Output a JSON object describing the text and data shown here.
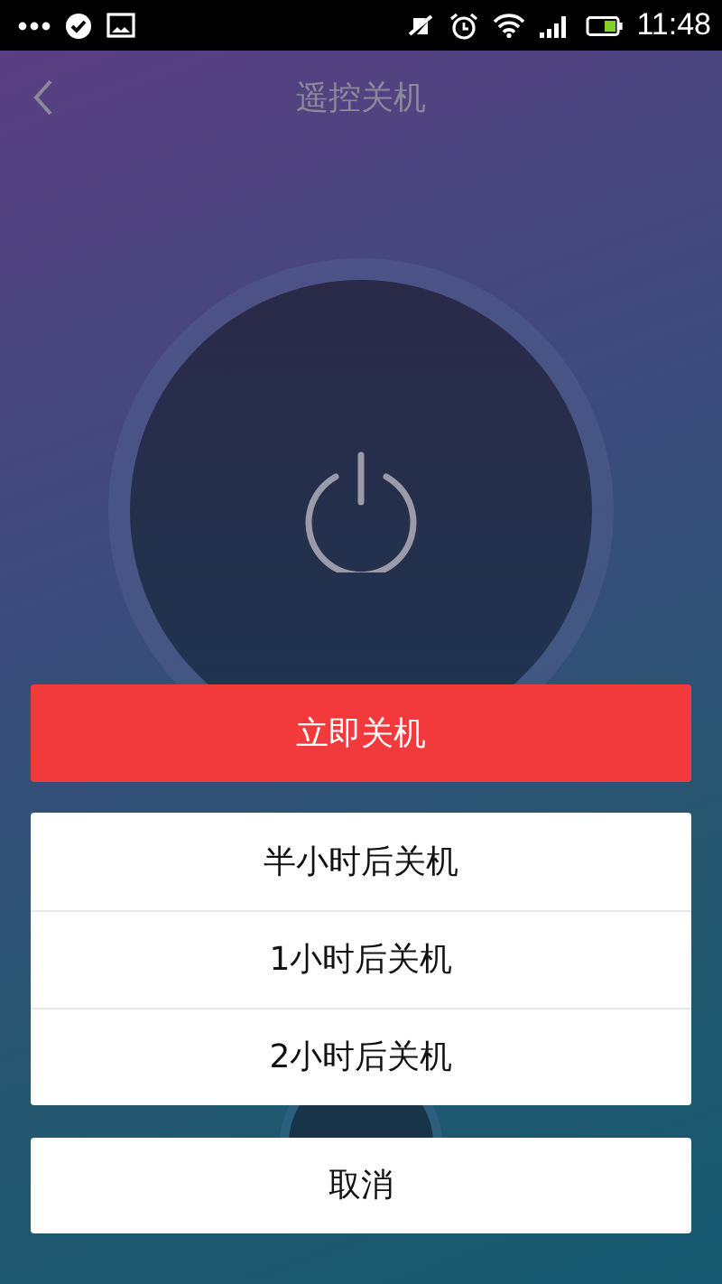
{
  "status_bar": {
    "time": "11:48"
  },
  "header": {
    "title": "遥控关机"
  },
  "sheet": {
    "primary_action": "立即关机",
    "options": [
      "半小时后关机",
      "1小时后关机",
      "2小时后关机"
    ],
    "cancel": "取消"
  }
}
